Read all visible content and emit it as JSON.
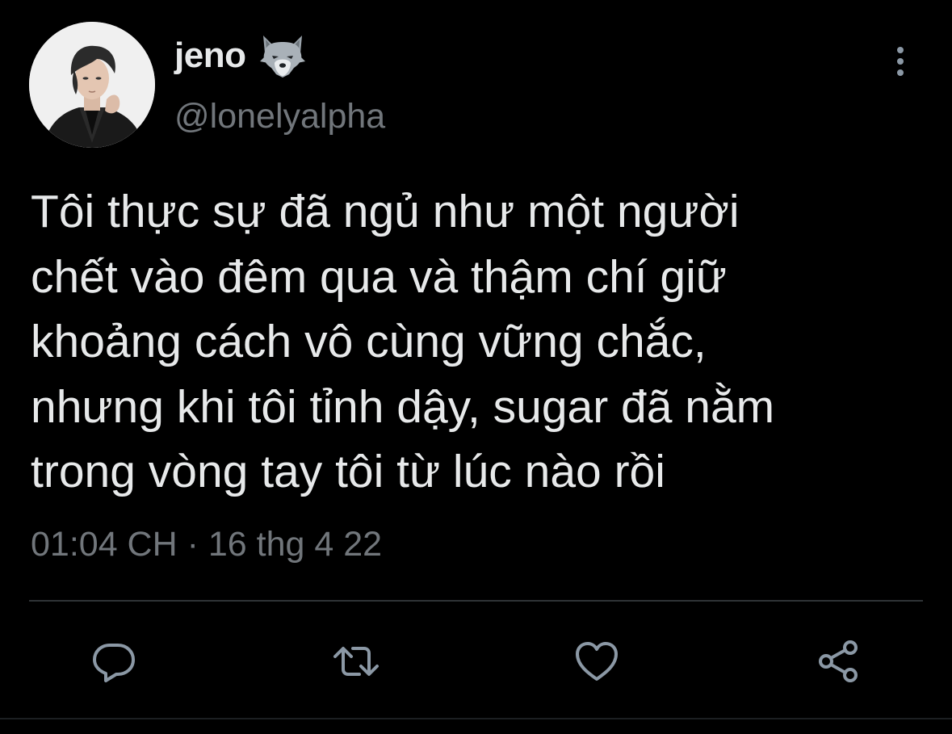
{
  "tweet": {
    "author": {
      "display_name": "jeno",
      "name_emoji": "wolf-icon",
      "handle": "@lonelyalpha",
      "avatar": "profile-photo"
    },
    "text": "Tôi thực sự đã ngủ như một người\nchết vào đêm qua và thậm chí giữ\nkhoảng cách vô cùng vững chắc,\nnhưng khi tôi tỉnh dậy, sugar đã nằm\ntrong vòng tay tôi từ lúc nào rồi",
    "time": "01:04 CH",
    "separator": " · ",
    "date": "16 thg 4 22"
  },
  "actions": [
    {
      "name": "reply",
      "icon": "reply-icon"
    },
    {
      "name": "retweet",
      "icon": "retweet-icon"
    },
    {
      "name": "like",
      "icon": "heart-icon"
    },
    {
      "name": "share",
      "icon": "share-icon"
    }
  ],
  "colors": {
    "background": "#000000",
    "primary_text": "#e7e9ea",
    "secondary_text": "#71767b",
    "divider": "#2f3336",
    "icon": "#8b98a5"
  }
}
